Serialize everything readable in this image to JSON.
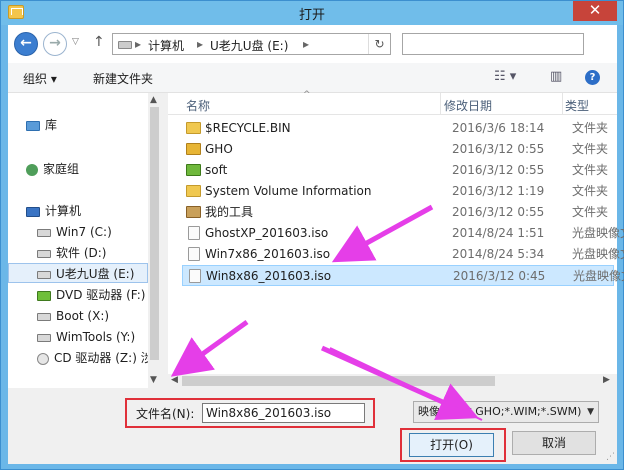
{
  "window": {
    "title": "打开",
    "close_label": "✕"
  },
  "nav": {
    "back_label": "←",
    "forward_label": "→",
    "recent_label": "▽",
    "up_label": "↑",
    "breadcrumb": [
      "计算机",
      "U老九U盘 (E:)"
    ],
    "crumb_sep": "▸",
    "refresh_label": "↻",
    "search_placeholder": ""
  },
  "toolbar": {
    "organize_label": "组织 ▾",
    "new_folder_label": "新建文件夹",
    "view_icon": "☷ ▾",
    "pane_icon": "▥",
    "help_label": "?"
  },
  "sidebar": {
    "items": [
      {
        "label": "库",
        "icon": "library-icon"
      },
      {
        "label": "家庭组",
        "icon": "homegroup-icon"
      },
      {
        "label": "计算机",
        "icon": "computer-icon"
      },
      {
        "label": "Win7 (C:)",
        "icon": "drive-icon"
      },
      {
        "label": "软件 (D:)",
        "icon": "drive-icon"
      },
      {
        "label": "U老九U盘 (E:)",
        "icon": "drive-icon",
        "selected": true
      },
      {
        "label": "DVD 驱动器 (F:)",
        "icon": "dvd-icon"
      },
      {
        "label": "Boot (X:)",
        "icon": "drive-icon"
      },
      {
        "label": "WimTools (Y:)",
        "icon": "drive-icon"
      },
      {
        "label": "CD 驱动器 (Z:) 涉",
        "icon": "cd-icon"
      }
    ]
  },
  "columns": {
    "name": "名称",
    "date": "修改日期",
    "type": "类型"
  },
  "files": [
    {
      "name": "$RECYCLE.BIN",
      "date": "2016/3/6 18:14",
      "type": "文件夹",
      "icon": "folder-icon"
    },
    {
      "name": "GHO",
      "date": "2016/3/12 0:55",
      "type": "文件夹",
      "icon": "folder-icon"
    },
    {
      "name": "soft",
      "date": "2016/3/12 0:55",
      "type": "文件夹",
      "icon": "folder-icon"
    },
    {
      "name": "System Volume Information",
      "date": "2016/3/12 1:19",
      "type": "文件夹",
      "icon": "folder-icon"
    },
    {
      "name": "我的工具",
      "date": "2016/3/12 0:55",
      "type": "文件夹",
      "icon": "folder-icon"
    },
    {
      "name": "GhostXP_201603.iso",
      "date": "2014/8/24 1:51",
      "type": "光盘映像文",
      "icon": "iso-file-icon"
    },
    {
      "name": "Win7x86_201603.iso",
      "date": "2014/8/24 5:34",
      "type": "光盘映像文",
      "icon": "iso-file-icon"
    },
    {
      "name": "Win8x86_201603.iso",
      "date": "2016/3/12 0:45",
      "type": "光盘映像文",
      "icon": "iso-file-icon",
      "selected": true
    }
  ],
  "bottom": {
    "filename_label": "文件名(N):",
    "filename_value": "Win8x86_201603.iso",
    "filetype_value": "映像文件(*.GHO;*.WIM;*.SWM)",
    "open_label": "打开(O)",
    "cancel_label": "取消"
  },
  "annotation": {
    "color": "#e53ee8",
    "box_color": "#e0303a"
  }
}
